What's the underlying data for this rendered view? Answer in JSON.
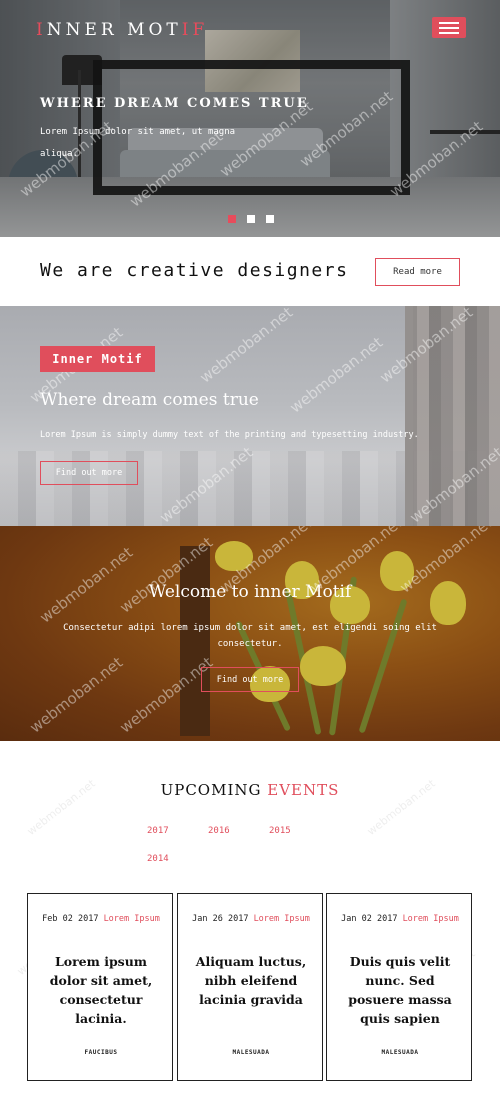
{
  "brand": {
    "logo_part1": "I",
    "logo_part2": "NNER MOT",
    "logo_part3": "IF"
  },
  "menu_icon": "hamburger-icon",
  "hero": {
    "title": "WHERE DREAM COMES TRUE",
    "description": "Lorem Ipsum dolor sit amet, ut magna aliqua.",
    "slides_total": 3,
    "active_slide": 1
  },
  "creative": {
    "title": "We are creative designers",
    "button": "Read more"
  },
  "dream": {
    "badge": "Inner Motif",
    "title": "Where dream comes true",
    "description": "Lorem Ipsum is simply dummy text of the printing and typesetting industry.",
    "button": "Find out more"
  },
  "welcome": {
    "title": "Welcome to inner Motif",
    "description": "Consectetur adipi lorem ipsum dolor sit amet, est eligendi soing elit consectetur.",
    "button": "Find out more"
  },
  "events": {
    "title_plain": "UPCOMING ",
    "title_accent": "EVENTS",
    "years": [
      "2017",
      "2016",
      "2015",
      "2014"
    ],
    "cards": [
      {
        "date": "Feb 02 2017",
        "tag": "Lorem Ipsum",
        "title": "Lorem ipsum dolor sit amet, consectetur lacinia.",
        "label": "FAUCIBUS"
      },
      {
        "date": "Jan 26 2017",
        "tag": "Lorem Ipsum",
        "title": "Aliquam luctus, nibh eleifend lacinia gravida",
        "label": "MALESUADA"
      },
      {
        "date": "Jan 02 2017",
        "tag": "Lorem Ipsum",
        "title": "Duis quis velit nunc. Sed posuere massa quis sapien",
        "label": "MALESUADA"
      }
    ]
  },
  "watermark": "webmoban.net",
  "colors": {
    "accent": "#e04e5c",
    "white": "#ffffff",
    "text": "#222222"
  }
}
